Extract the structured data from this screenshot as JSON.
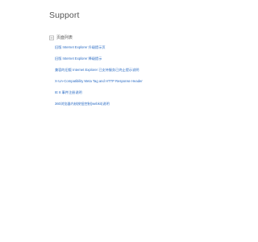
{
  "page": {
    "title": "Support"
  },
  "section": {
    "label": "页面列表",
    "toggle_icon": "collapse-toggle-icon"
  },
  "links": [
    {
      "label": "旧版 Internet Explorer 升级提示页"
    },
    {
      "label": "旧版 Internet Explorer 降级提示"
    },
    {
      "label": "兼容的旧版 Internet Explorer 已支持服务已终止提示说明"
    },
    {
      "label": "X-UA-Compatibility Meta Tag and HTTP Response Header"
    },
    {
      "label": "IE 8 事件注册说明"
    },
    {
      "label": "360浏览器内核按钮控制(webkit)说明"
    }
  ],
  "colors": {
    "link": "#2b6cc4",
    "text": "#555555",
    "background": "#ffffff"
  }
}
